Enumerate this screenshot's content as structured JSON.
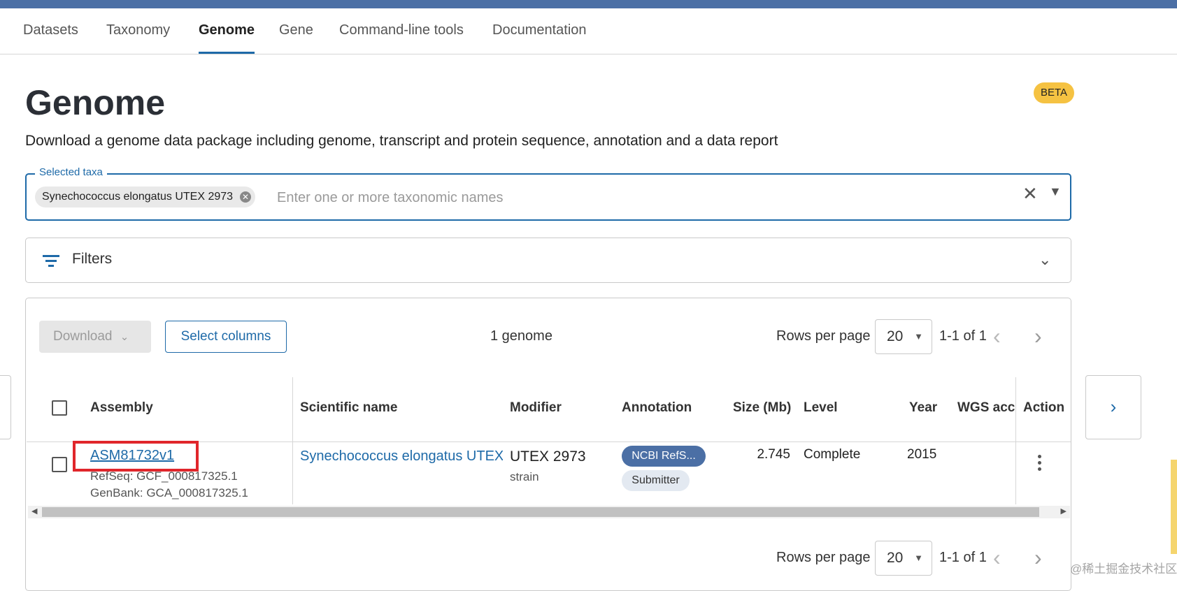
{
  "nav": {
    "tabs": [
      {
        "label": "Datasets"
      },
      {
        "label": "Taxonomy"
      },
      {
        "label": "Genome",
        "active": true
      },
      {
        "label": "Gene"
      },
      {
        "label": "Command-line tools"
      },
      {
        "label": "Documentation"
      }
    ]
  },
  "page": {
    "title": "Genome",
    "badge": "BETA",
    "subtitle": "Download a genome data package including genome, transcript and protein sequence, annotation and a data report"
  },
  "taxa": {
    "legend": "Selected taxa",
    "chip": "Synechococcus elongatus UTEX 2973",
    "placeholder": "Enter one or more taxonomic names"
  },
  "filters": {
    "label": "Filters"
  },
  "toolbar": {
    "download_label": "Download",
    "select_columns_label": "Select columns",
    "count_text": "1 genome"
  },
  "pagination": {
    "rows_per_page_label": "Rows per page",
    "rows_per_page_value": "20",
    "range_text": "1-1 of 1"
  },
  "table": {
    "headers": {
      "assembly": "Assembly",
      "scientific_name": "Scientific name",
      "modifier": "Modifier",
      "annotation": "Annotation",
      "size": "Size (Mb)",
      "level": "Level",
      "year": "Year",
      "wgs": "WGS acce",
      "action": "Action"
    },
    "rows": [
      {
        "assembly": "ASM81732v1",
        "refseq": "RefSeq: GCF_000817325.1",
        "genbank": "GenBank: GCA_000817325.1",
        "scientific_name": "Synechococcus elongatus UTEX",
        "modifier": "UTEX 2973",
        "modifier_type": "strain",
        "annotation_primary": "NCBI RefS...",
        "annotation_secondary": "Submitter",
        "size": "2.745",
        "level": "Complete",
        "year": "2015"
      }
    ]
  },
  "colors": {
    "accent": "#1e6aa8",
    "top_bar": "#4b6fa5",
    "beta_badge": "#f5c242",
    "highlight_box": "#e0262b"
  },
  "watermark": "@稀土掘金技术社区"
}
